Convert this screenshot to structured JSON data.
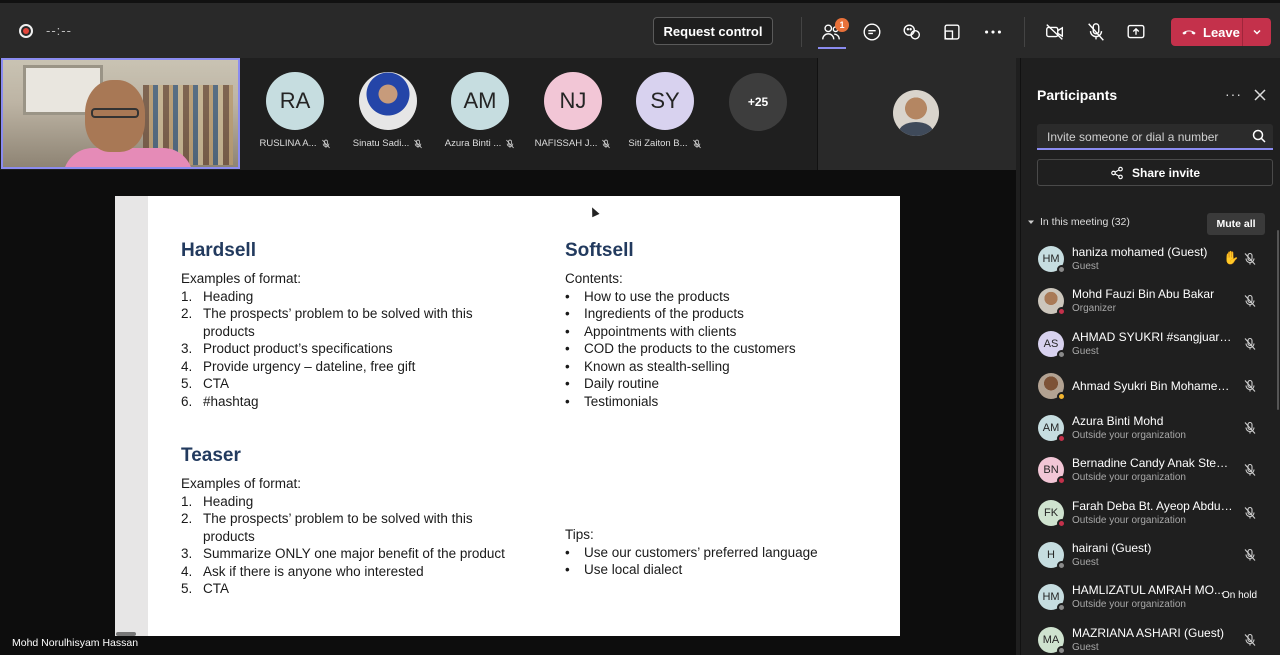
{
  "topbar": {
    "timer": "--:--",
    "request_control": "Request control",
    "people_badge": "1",
    "leave_label": "Leave",
    "colors": {
      "leave": "#c4314b",
      "accent": "#8b8cf0",
      "badge": "#e8713a"
    }
  },
  "video_strip": {
    "tiles": [
      {
        "initials": "RA",
        "name": "RUSLINA A...",
        "bg": "#c6dde0"
      },
      {
        "initials": "",
        "name": "Sinatu Sadi...",
        "bg": "#d6d6d6",
        "photo": true
      },
      {
        "initials": "AM",
        "name": "Azura Binti ...",
        "bg": "#c6dde0"
      },
      {
        "initials": "NJ",
        "name": "NAFISSAH J...",
        "bg": "#f2c6d6"
      },
      {
        "initials": "SY",
        "name": "Siti Zaiton B...",
        "bg": "#d8d2ef"
      }
    ],
    "more_count": "+25"
  },
  "presenter_name": "Mohd Norulhisyam Hassan",
  "slide": {
    "hardsell": {
      "title": "Hardsell",
      "subtitle": "Examples of format:",
      "items": [
        {
          "n": "1.",
          "t": "Heading"
        },
        {
          "n": "2.",
          "t": "The prospects’ problem to be solved with this products"
        },
        {
          "n": "3.",
          "t": "Product product’s specifications"
        },
        {
          "n": "4.",
          "t": "Provide urgency – dateline, free gift"
        },
        {
          "n": "5.",
          "t": "CTA"
        },
        {
          "n": "6.",
          "t": "#hashtag"
        }
      ]
    },
    "softsell": {
      "title": "Softsell",
      "subtitle": "Contents:",
      "items": [
        "How to use the products",
        "Ingredients of the products",
        "Appointments with clients",
        "COD the products to the customers",
        "Known as stealth-selling",
        "Daily routine",
        "Testimonials"
      ]
    },
    "teaser": {
      "title": "Teaser",
      "subtitle": "Examples of format:",
      "items": [
        {
          "n": "1.",
          "t": "Heading"
        },
        {
          "n": "2.",
          "t": "The prospects’ problem to be solved with this products"
        },
        {
          "n": "3.",
          "t": "Summarize ONLY one major benefit of the product"
        },
        {
          "n": "4.",
          "t": "Ask if there is anyone who interested"
        },
        {
          "n": "5.",
          "t": "CTA"
        }
      ]
    },
    "tips": {
      "subtitle": "Tips:",
      "items": [
        "Use our customers’ preferred language",
        "Use local dialect"
      ]
    }
  },
  "panel": {
    "title": "Participants",
    "search_placeholder": "Invite someone or dial a number",
    "share_invite": "Share invite",
    "group_label": "In this meeting (32)",
    "mute_all": "Mute all",
    "participants": [
      {
        "initials": "HM",
        "name": "haniza mohamed (Guest)",
        "role": "Guest",
        "bg": "#c6dde0",
        "status": "#8a8a8a",
        "hand": true
      },
      {
        "initials": "",
        "name": "Mohd Fauzi Bin Abu Bakar",
        "role": "Organizer",
        "bg": "",
        "photo": "photo",
        "status": "#c4314b"
      },
      {
        "initials": "AS",
        "name": "AHMAD SYUKRI #sangjuara (...",
        "role": "Guest",
        "bg": "#d8d2ef",
        "status": "#8a8a8a"
      },
      {
        "initials": "",
        "name": "Ahmad Syukri Bin Mohamed ...",
        "role": "",
        "bg": "",
        "photo": "photo2",
        "status": "#f3b52e"
      },
      {
        "initials": "AM",
        "name": "Azura Binti Mohd",
        "role": "Outside your organization",
        "bg": "#c6dde0",
        "status": "#c4314b"
      },
      {
        "initials": "BN",
        "name": "Bernadine Candy Anak Steph...",
        "role": "Outside your organization",
        "bg": "#f2c6d6",
        "status": "#c4314b"
      },
      {
        "initials": "FK",
        "name": "Farah Deba Bt. Ayeop Abdul ...",
        "role": "Outside your organization",
        "bg": "#cfe3cf",
        "status": "#c4314b"
      },
      {
        "initials": "H",
        "name": "hairani (Guest)",
        "role": "Guest",
        "bg": "#c6dde0",
        "status": "#8a8a8a"
      },
      {
        "initials": "HM",
        "name": "HAMLIZATUL AMRAH MO...",
        "role": "Outside your organization",
        "bg": "#c6dde0",
        "status": "#8a8a8a",
        "on_hold": "On hold"
      },
      {
        "initials": "MA",
        "name": "MAZRIANA ASHARI (Guest)",
        "role": "Guest",
        "bg": "#cfe3cf",
        "status": "#8a8a8a"
      }
    ]
  }
}
